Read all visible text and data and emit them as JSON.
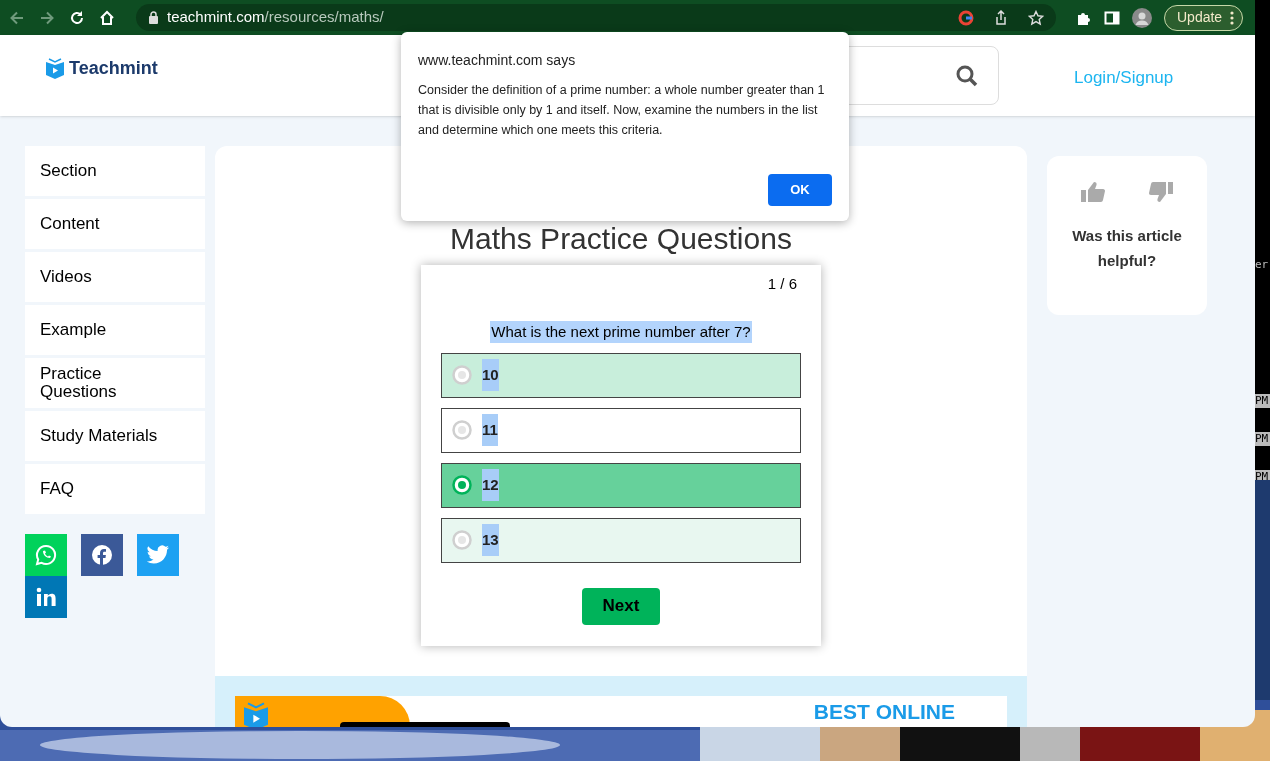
{
  "browser": {
    "url_host": "teachmint.com",
    "url_path": "/resources/maths/",
    "update_label": "Update"
  },
  "header": {
    "logo_text": "Teachmint",
    "login_label": "Login/Signup"
  },
  "sidebar": {
    "items": [
      {
        "label": "Section"
      },
      {
        "label": "Content"
      },
      {
        "label": "Videos"
      },
      {
        "label": "Example"
      },
      {
        "label": "Practice Questions"
      },
      {
        "label": "Study Materials"
      },
      {
        "label": "FAQ"
      }
    ]
  },
  "share_buttons": [
    {
      "kind": "whatsapp",
      "color": "#00d25b"
    },
    {
      "kind": "facebook",
      "color": "#3b5998"
    },
    {
      "kind": "twitter",
      "color": "#1da1f2"
    },
    {
      "kind": "linkedin",
      "color": "#0077b5"
    }
  ],
  "page_title": "Maths Practice Questions",
  "quiz": {
    "counter": "1 / 6",
    "question": "What is the next prime number after 7?",
    "question_text_selected": true,
    "options": [
      {
        "label": "10",
        "selected": false,
        "color": "#c8eedb",
        "text_selected": true
      },
      {
        "label": "11",
        "selected": false,
        "color": "#ffffff",
        "text_selected": true
      },
      {
        "label": "12",
        "selected": true,
        "color": "#66d19b",
        "text_selected": true
      },
      {
        "label": "13",
        "selected": false,
        "color": "#e8f7f0",
        "text_selected": true
      }
    ],
    "next_label": "Next"
  },
  "feedback": {
    "question": "Was this article helpful?"
  },
  "banner": {
    "headline": "BEST ONLINE"
  },
  "dialog": {
    "title": "www.teachmint.com says",
    "message": "Consider the definition of a prime number: a whole number greater than 1 that is divisible only by 1 and itself. Now, examine the numbers in the list and determine which one meets this criteria.",
    "ok_label": "OK"
  },
  "background_window": {
    "texts": [
      "er",
      "PM",
      "PM",
      "PM"
    ]
  }
}
